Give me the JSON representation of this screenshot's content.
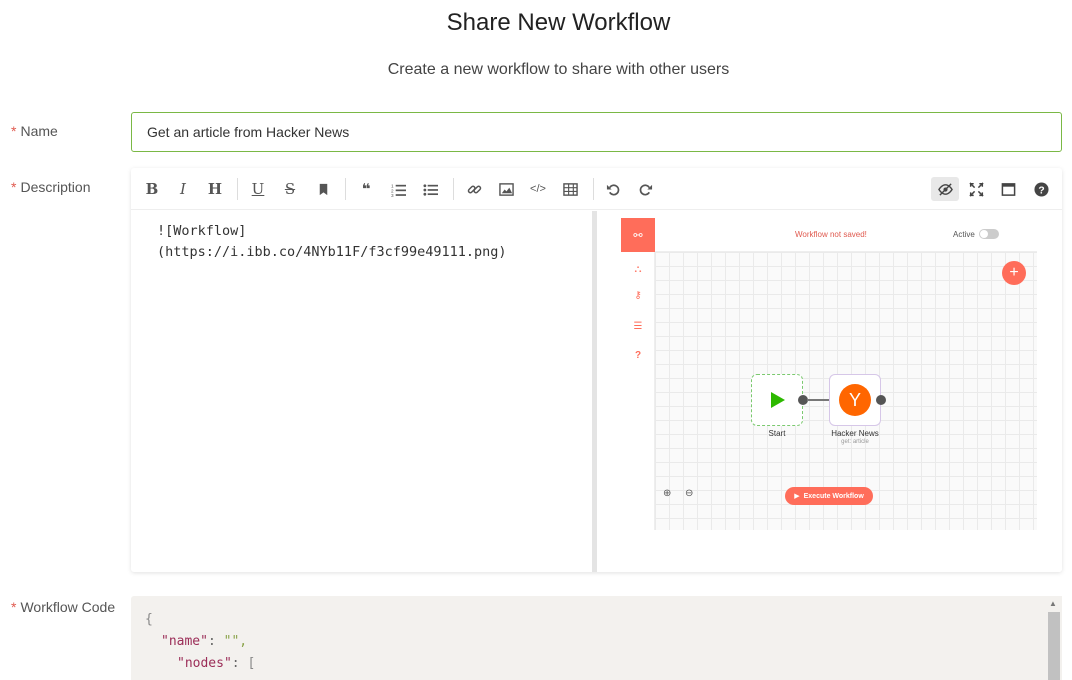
{
  "header": {
    "title": "Share New Workflow",
    "subtitle": "Create a new workflow to share with other users"
  },
  "form": {
    "name": {
      "label": "Name",
      "value": "Get an article from Hacker News",
      "required_mark": "*"
    },
    "description": {
      "label": "Description",
      "required_mark": "*",
      "markdown_line1": "![Workflow]",
      "markdown_line2": "(https://i.ibb.co/4NYb11F/f3cf99e49111.png)"
    },
    "workflow_code": {
      "label": "Workflow Code",
      "required_mark": "*",
      "line1": "{",
      "line2_key": "\"name\"",
      "line2_sep": ": ",
      "line2_val": "\"\",",
      "line3_key": "\"nodes\"",
      "line3_sep": ": ",
      "line3_val": "["
    }
  },
  "toolbar": {
    "items": [
      "bold",
      "italic",
      "heading",
      "underline",
      "strikethrough",
      "bookmark",
      "quote",
      "ordered-list",
      "unordered-list",
      "link",
      "image",
      "code",
      "table",
      "undo",
      "redo",
      "preview",
      "fullscreen",
      "side-by-side",
      "help"
    ]
  },
  "preview_image": {
    "status_text": "Workflow not saved!",
    "active_label": "Active",
    "start_label": "Start",
    "hn_label": "Hacker News",
    "hn_sub": "get: article",
    "execute_label": "Execute Workflow"
  },
  "colors": {
    "accent_green": "#7ab845",
    "required_red": "#e05a4f",
    "n8n_orange": "#ff6d5a",
    "hn_orange": "#ff6600"
  }
}
